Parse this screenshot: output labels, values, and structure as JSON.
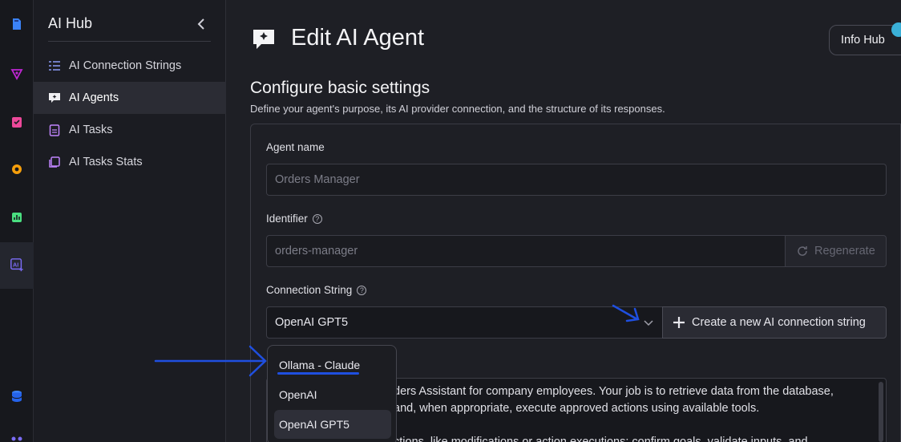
{
  "rail": {
    "icons": [
      "documents-icon",
      "graphql-icon",
      "tasks-icon",
      "settings-icon",
      "stats-icon",
      "ai-icon",
      "database-icon",
      "cluster-icon"
    ]
  },
  "sidebar": {
    "title": "AI Hub",
    "items": [
      {
        "label": "AI Connection Strings",
        "icon": "list-icon"
      },
      {
        "label": "AI Agents",
        "icon": "chat-icon"
      },
      {
        "label": "AI Tasks",
        "icon": "clipboard-icon"
      },
      {
        "label": "AI Tasks Stats",
        "icon": "stats-list-icon"
      }
    ]
  },
  "header": {
    "title": "Edit AI Agent",
    "info_hub": "Info Hub"
  },
  "section": {
    "title": "Configure basic settings",
    "subtitle": "Define your agent's purpose, its AI provider connection, and the structure of its responses."
  },
  "form": {
    "agent_name_label": "Agent name",
    "agent_name_placeholder": "Orders Manager",
    "identifier_label": "Identifier",
    "identifier_value": "orders-manager",
    "regenerate_label": "Regenerate",
    "connection_label": "Connection String",
    "connection_value": "OpenAI GPT5",
    "create_connection_label": "Create a new AI connection string",
    "prompt_line1": "ders Assistant for company employees. Your job is to retrieve data from the database,",
    "prompt_line2": "and, when appropriate, execute approved actions using available tools.",
    "prompt_line3": "ctions, like modifications or action executions: confirm goals, validate inputs, and"
  },
  "dropdown": {
    "options": [
      "Ollama - Claude",
      "OpenAI",
      "OpenAI GPT5"
    ],
    "selected": "OpenAI GPT5"
  },
  "colors": {
    "accent": "#1f4fe0",
    "ai_purple": "#7b6cf6",
    "info_dot": "#3ab0d8"
  }
}
